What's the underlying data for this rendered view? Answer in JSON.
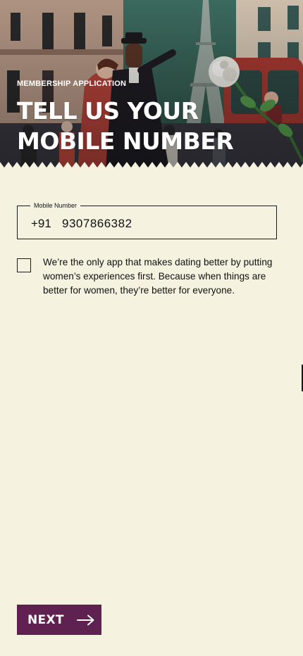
{
  "header": {
    "eyebrow": "MEMBERSHIP APPLICATION",
    "title_line1": "TELL US YOUR",
    "title_line2": "MOBILE NUMBER",
    "hero_image": "paris-street-illustration-with-rose"
  },
  "phone": {
    "label": "Mobile Number",
    "country_code": "+91",
    "value": "9307866382"
  },
  "consent": {
    "checked": false,
    "text": "We’re the only app that makes dating better by putting women’s experiences first. Because when things are better for women, they’re better for everyone."
  },
  "footer": {
    "next_label": "NEXT",
    "next_icon": "arrow-right-icon"
  },
  "colors": {
    "background": "#f5f2df",
    "primary": "#5e2150",
    "text": "#111111"
  }
}
